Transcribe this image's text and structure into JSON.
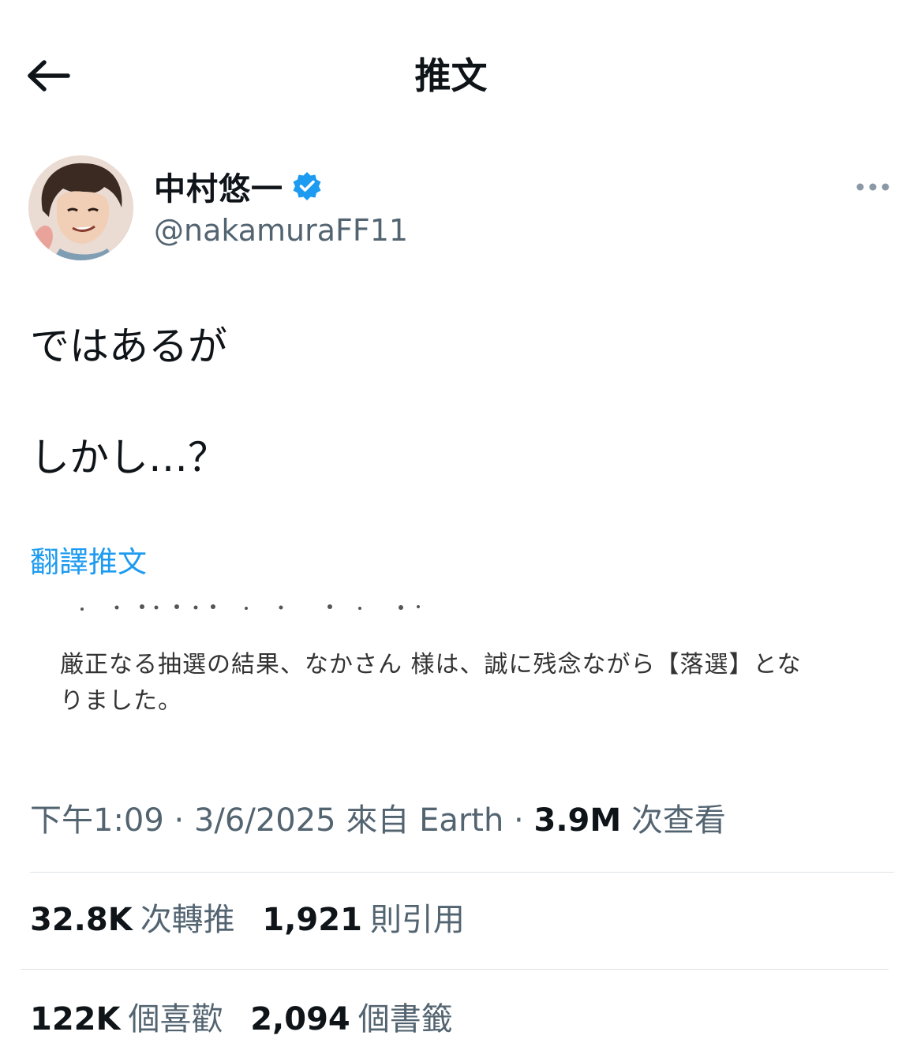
{
  "header": {
    "title": "推文"
  },
  "author": {
    "name": "中村悠一",
    "handle": "@nakamuraFF11",
    "verified": true
  },
  "tweet": {
    "lines": [
      "ではあるが",
      "しかし…？"
    ],
    "translate_label": "翻譯推文"
  },
  "media": {
    "text_line1": "厳正なる抽選の結果、なかさん 様は、誠に残念ながら【落選】とな",
    "text_line2": "りました。"
  },
  "meta": {
    "time": "下午1:09",
    "sep1": " · ",
    "date": "3/6/2025",
    "source": " 來自 Earth",
    "sep2": " · ",
    "views_count": "3.9M",
    "views_label": " 次查看"
  },
  "stats": {
    "retweets": {
      "count": "32.8K",
      "label": "次轉推"
    },
    "quotes": {
      "count": "1,921",
      "label": "則引用"
    },
    "likes": {
      "count": "122K",
      "label": "個喜歡"
    },
    "bookmarks": {
      "count": "2,094",
      "label": "個書籤"
    }
  },
  "colors": {
    "accent": "#1d9bf0",
    "text": "#0f1419",
    "secondary": "#536471"
  }
}
